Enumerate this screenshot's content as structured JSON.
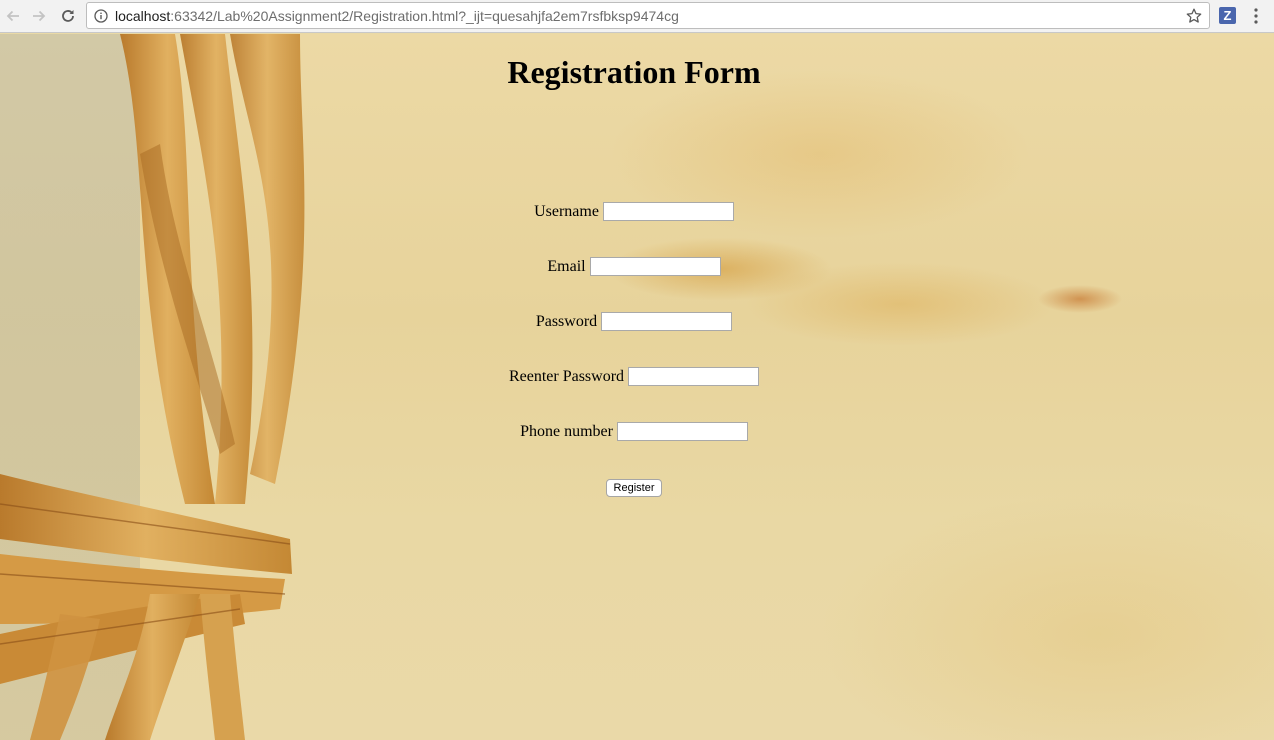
{
  "browser": {
    "url_host": "localhost",
    "url_rest": ":63342/Lab%20Assignment2/Registration.html?_ijt=quesahjfa2em7rsfbksp9474cg",
    "extension_label": "Z"
  },
  "form": {
    "title": "Registration Form",
    "fields": [
      {
        "label": "Username",
        "value": ""
      },
      {
        "label": "Email",
        "value": ""
      },
      {
        "label": "Password",
        "value": ""
      },
      {
        "label": "Reenter Password",
        "value": ""
      },
      {
        "label": "Phone number",
        "value": ""
      }
    ],
    "register_label": "Register"
  },
  "colors": {
    "page_background": "#e9d9a6",
    "raffia": "#d9a04a",
    "extension_badge": "#4a66ad"
  }
}
